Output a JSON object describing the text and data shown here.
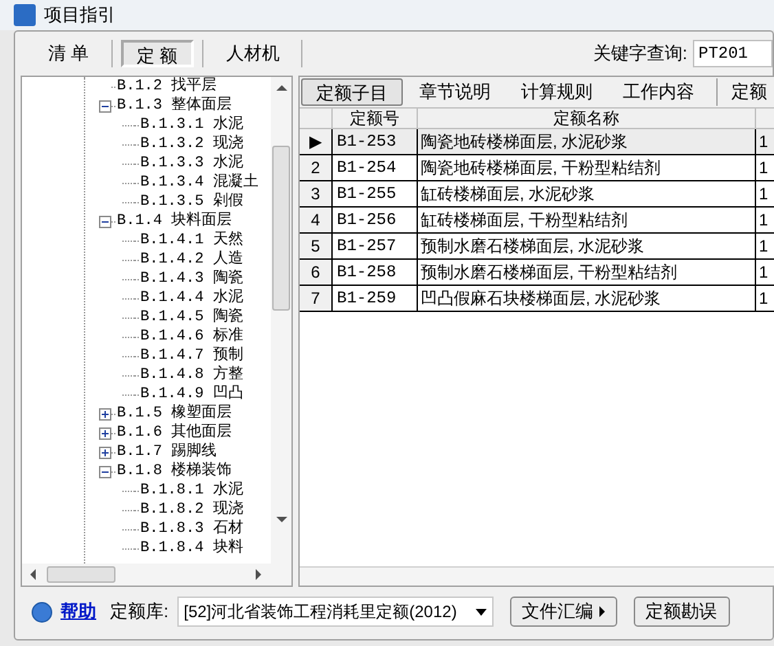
{
  "window": {
    "title": "项目指引"
  },
  "mode_tabs": [
    {
      "label": "清 单",
      "selected": false
    },
    {
      "label": "定 额",
      "selected": true
    },
    {
      "label": "人材机",
      "selected": false
    }
  ],
  "search": {
    "label": "关键字查询:",
    "value": "PT201"
  },
  "tree": [
    {
      "label": "B.1.2 找平层"
    },
    {
      "label": "B.1.3 整体面层",
      "expanded": true,
      "children": [
        {
          "label": "B.1.3.1 水泥"
        },
        {
          "label": "B.1.3.2 现浇"
        },
        {
          "label": "B.1.3.3 水泥"
        },
        {
          "label": "B.1.3.4 混凝土"
        },
        {
          "label": "B.1.3.5 剁假"
        }
      ]
    },
    {
      "label": "B.1.4 块料面层",
      "expanded": true,
      "children": [
        {
          "label": "B.1.4.1 天然"
        },
        {
          "label": "B.1.4.2 人造"
        },
        {
          "label": "B.1.4.3 陶瓷"
        },
        {
          "label": "B.1.4.4 水泥"
        },
        {
          "label": "B.1.4.5 陶瓷"
        },
        {
          "label": "B.1.4.6 标准"
        },
        {
          "label": "B.1.4.7 预制"
        },
        {
          "label": "B.1.4.8 方整"
        },
        {
          "label": "B.1.4.9 凹凸"
        }
      ]
    },
    {
      "label": "B.1.5 橡塑面层",
      "expanded": false
    },
    {
      "label": "B.1.6 其他面层",
      "expanded": false
    },
    {
      "label": "B.1.7 踢脚线",
      "expanded": false
    },
    {
      "label": "B.1.8 楼梯装饰",
      "expanded": true,
      "children": [
        {
          "label": "B.1.8.1 水泥"
        },
        {
          "label": "B.1.8.2 现浇"
        },
        {
          "label": "B.1.8.3 石材"
        },
        {
          "label": "B.1.8.4 块料"
        }
      ]
    }
  ],
  "detail_tabs": [
    {
      "label": "定额子目",
      "selected": true
    },
    {
      "label": "章节说明",
      "selected": false
    },
    {
      "label": "计算规则",
      "selected": false
    },
    {
      "label": "工作内容",
      "selected": false
    },
    {
      "label": "定额",
      "selected": false
    }
  ],
  "table": {
    "columns": [
      "定额号",
      "定额名称"
    ],
    "rows": [
      {
        "marker": "▶",
        "code": "B1-253",
        "name": "陶瓷地砖楼梯面层, 水泥砂浆",
        "column_4": "1",
        "selected": true
      },
      {
        "marker": "2",
        "code": "B1-254",
        "name": "陶瓷地砖楼梯面层, 干粉型粘结剂",
        "column_4": "1",
        "selected": false
      },
      {
        "marker": "3",
        "code": "B1-255",
        "name": "缸砖楼梯面层, 水泥砂浆",
        "column_4": "1",
        "selected": false
      },
      {
        "marker": "4",
        "code": "B1-256",
        "name": "缸砖楼梯面层, 干粉型粘结剂",
        "column_4": "1",
        "selected": false
      },
      {
        "marker": "5",
        "code": "B1-257",
        "name": "预制水磨石楼梯面层, 水泥砂浆",
        "column_4": "1",
        "selected": false
      },
      {
        "marker": "6",
        "code": "B1-258",
        "name": "预制水磨石楼梯面层, 干粉型粘结剂",
        "column_4": "1",
        "selected": false
      },
      {
        "marker": "7",
        "code": "B1-259",
        "name": "凹凸假麻石块楼梯面层, 水泥砂浆",
        "column_4": "1",
        "selected": false
      }
    ]
  },
  "footer": {
    "help_link": "帮助",
    "library_label": "定额库:",
    "library_value": "[52]河北省装饰工程消耗里定额(2012)",
    "buttons": [
      {
        "label": "文件汇编",
        "kind": "menu"
      },
      {
        "label": "定额勘误",
        "kind": "plain"
      }
    ]
  }
}
